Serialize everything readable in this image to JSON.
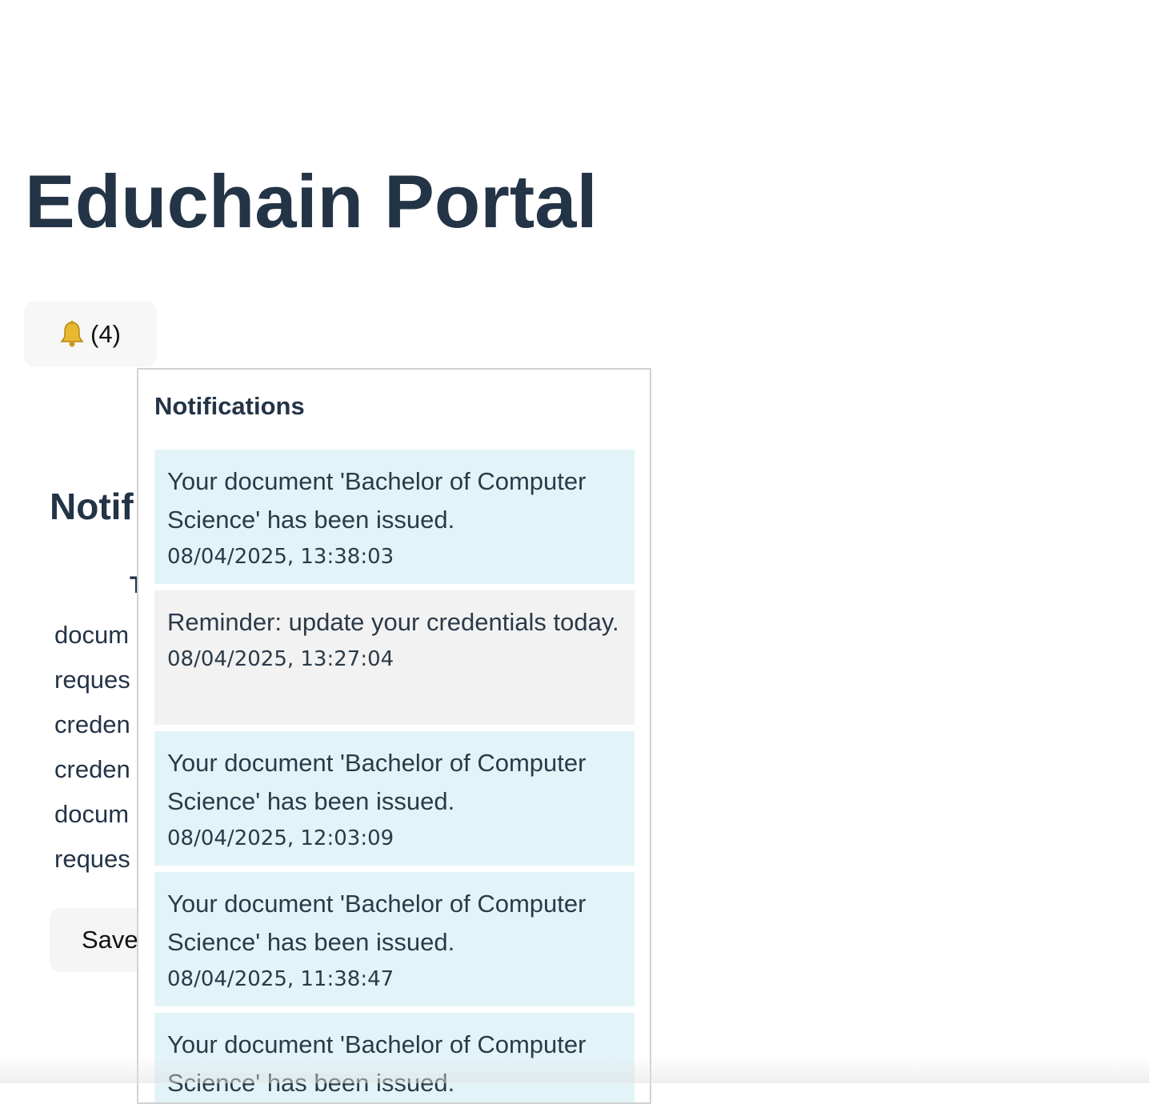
{
  "app": {
    "title": "Educhain Portal"
  },
  "bell": {
    "icon": "bell-icon",
    "count_label": "(4)"
  },
  "settings": {
    "title_visible": "Notif",
    "header_fragment": "T",
    "rows": [
      {
        "label": "docum"
      },
      {
        "label": "reques"
      },
      {
        "label": "creden"
      },
      {
        "label": "creden"
      },
      {
        "label": "docum"
      },
      {
        "label": "reques"
      }
    ],
    "save_label": "Save"
  },
  "dropdown": {
    "title": "Notifications",
    "items": [
      {
        "message": "Your document 'Bachelor of Computer Science' has been issued.",
        "time": "08/04/2025, 13:38:03",
        "state": "unread"
      },
      {
        "message": "Reminder: update your credentials today.",
        "time": "08/04/2025, 13:27:04",
        "state": "read"
      },
      {
        "message": "Your document 'Bachelor of Computer Science' has been issued.",
        "time": "08/04/2025, 12:03:09",
        "state": "unread"
      },
      {
        "message": "Your document 'Bachelor of Computer Science' has been issued.",
        "time": "08/04/2025, 11:38:47",
        "state": "unread"
      },
      {
        "message": "Your document 'Bachelor of Computer Science' has been issued.",
        "time": "",
        "state": "unread"
      }
    ]
  },
  "colors": {
    "heading": "#243447",
    "unread_bg": "#e3f4f9",
    "read_bg": "#f2f2f2"
  }
}
